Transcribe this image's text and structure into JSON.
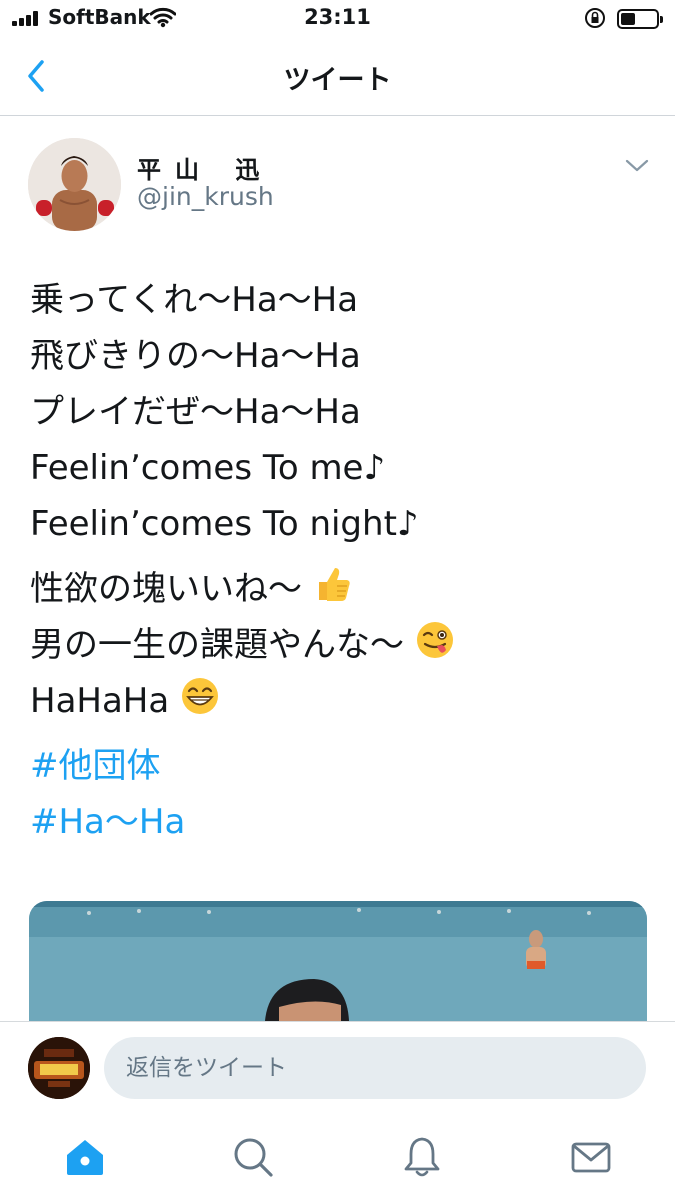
{
  "status_bar": {
    "carrier": "SoftBank",
    "time": "23:11"
  },
  "nav": {
    "title": "ツイート"
  },
  "tweet": {
    "author_name": "平山 迅",
    "author_handle": "@jin_krush",
    "lines": [
      "乗ってくれ〜Ha〜Ha",
      "飛びきりの〜Ha〜Ha",
      "プレイだぜ〜Ha〜Ha",
      "Feelin’comes To me♪",
      "Feelin’comes To night♪",
      "性欲の塊いいね〜",
      "男の一生の課題やんな〜",
      "HaHaHa"
    ],
    "hashtags": [
      "#他団体",
      "#Ha〜Ha"
    ]
  },
  "reply_bar": {
    "placeholder": "返信をツイート"
  },
  "tabs": [
    {
      "icon": "home-icon"
    },
    {
      "icon": "search-icon"
    },
    {
      "icon": "bell-icon"
    },
    {
      "icon": "mail-icon"
    }
  ],
  "colors": {
    "accent": "#1da1f2",
    "secondary_text": "#657786",
    "divider": "#d0d5da",
    "input_background": "#e6ecf0"
  }
}
